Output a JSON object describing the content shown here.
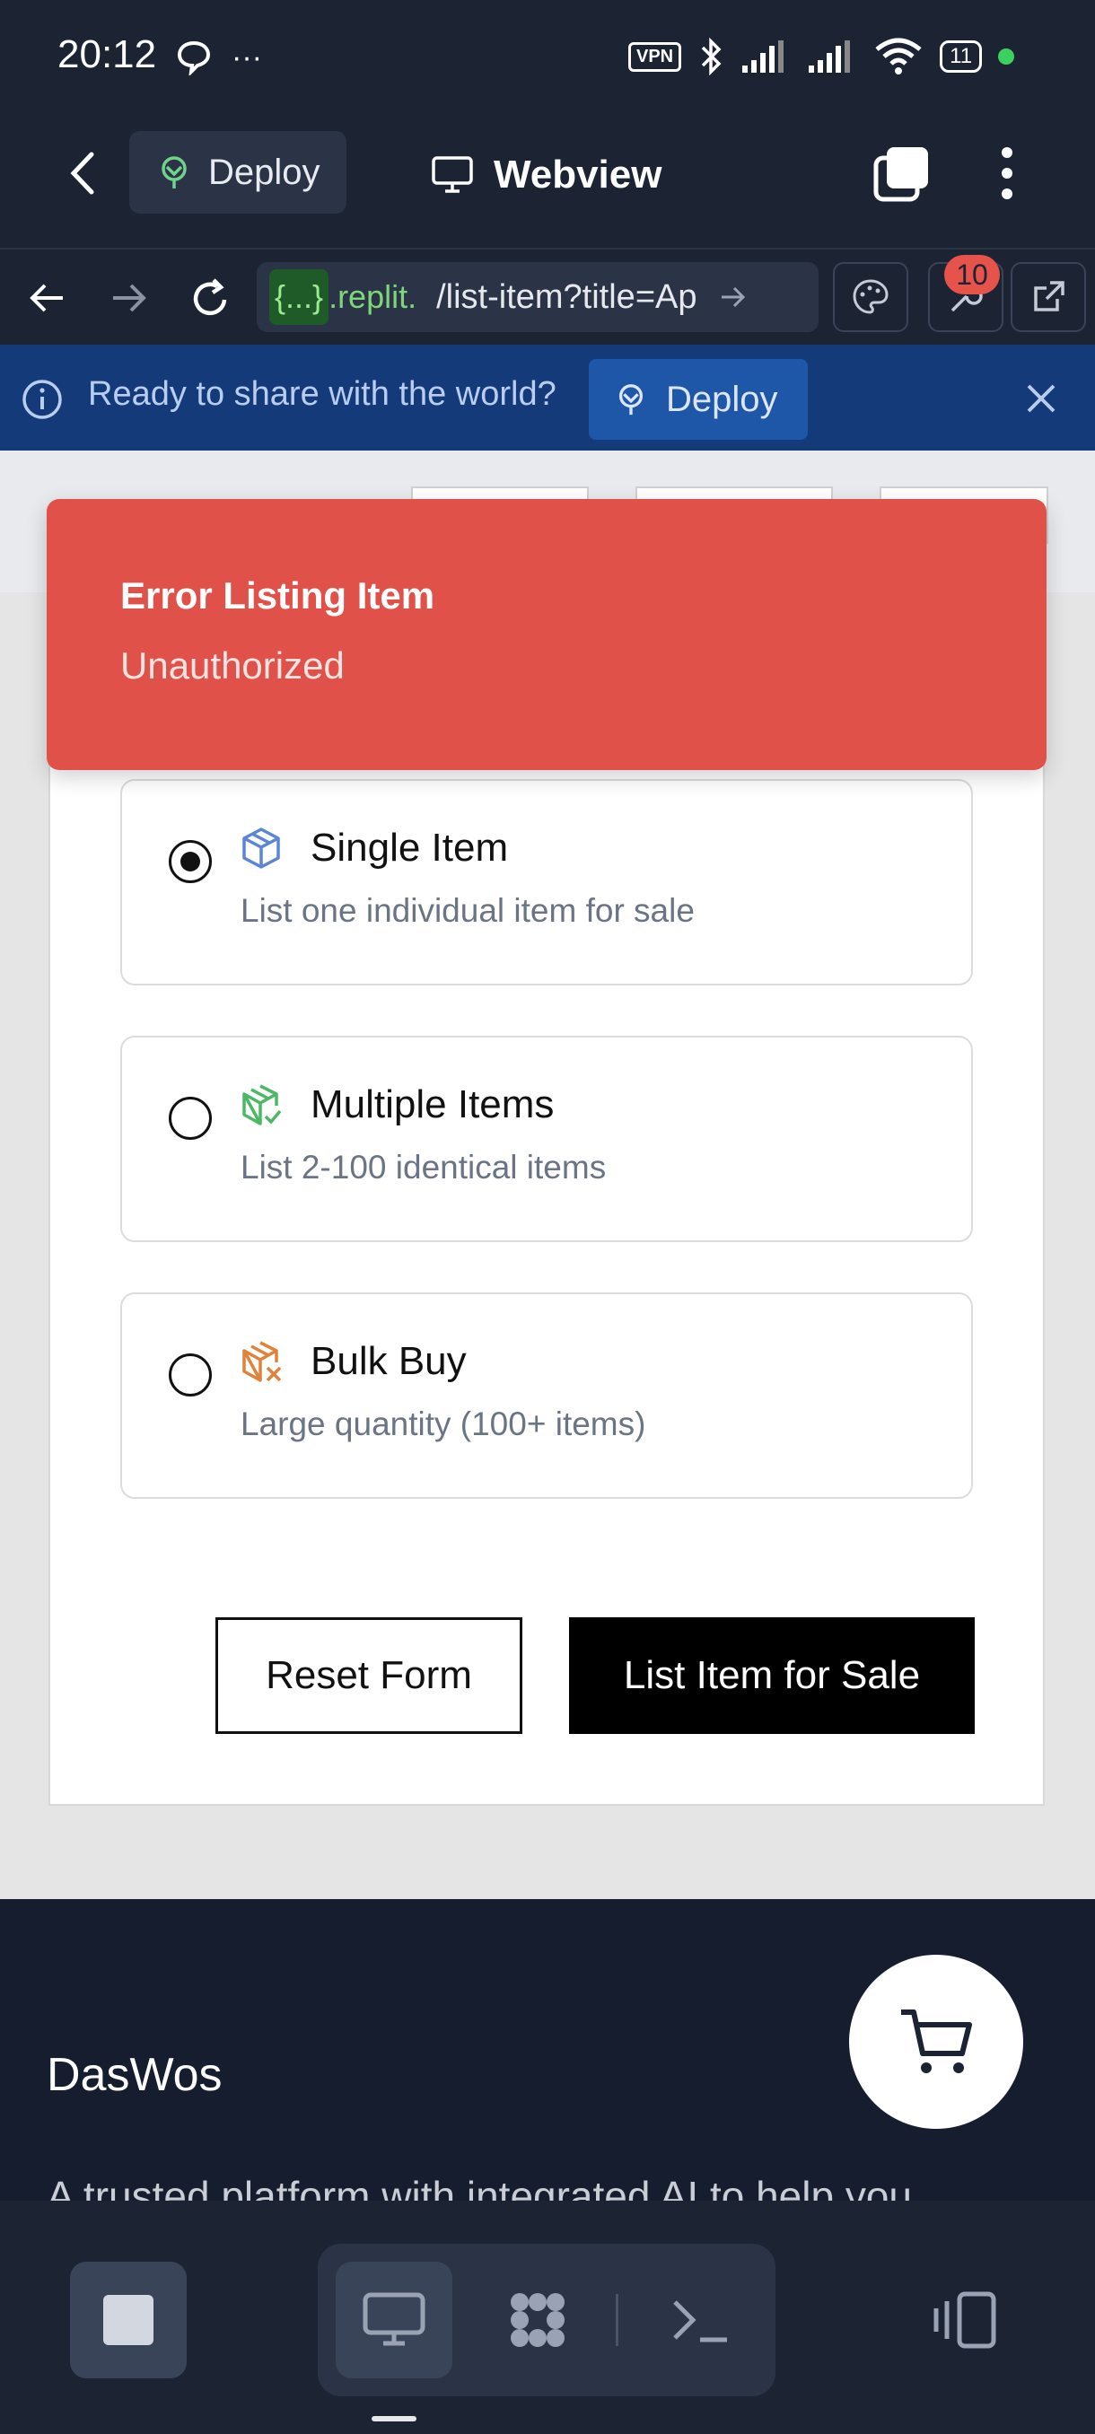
{
  "status_bar": {
    "time": "20:12",
    "vpn": "VPN",
    "battery": "11",
    "more": "···"
  },
  "app_bar": {
    "deploy_label": "Deploy",
    "title": "Webview"
  },
  "url_bar": {
    "host": "{...}",
    "host_rest": ".replit.",
    "path": "/list-item?title=Ap",
    "badge_count": "10"
  },
  "banner": {
    "text": "Ready to share with the world?",
    "deploy_label": "Deploy"
  },
  "toast": {
    "title": "Error Listing Item",
    "description": "Unauthorized"
  },
  "listing_options": [
    {
      "title": "Single Item",
      "description": "List one individual item for sale",
      "selected": true,
      "icon": "box-icon",
      "color": "#5b85d6"
    },
    {
      "title": "Multiple Items",
      "description": "List 2-100 identical items",
      "selected": false,
      "icon": "box-check-icon",
      "color": "#4cb865"
    },
    {
      "title": "Bulk Buy",
      "description": "Large quantity (100+ items)",
      "selected": false,
      "icon": "box-x-icon",
      "color": "#e0823a"
    }
  ],
  "actions": {
    "reset_label": "Reset Form",
    "submit_label": "List Item for Sale"
  },
  "footer": {
    "brand": "DasWos",
    "tagline": "A trusted platform with integrated AI to help you"
  },
  "colors": {
    "toast_bg": "#e0514a",
    "banner_bg": "#143a7a",
    "app_bg": "#1c2333"
  }
}
